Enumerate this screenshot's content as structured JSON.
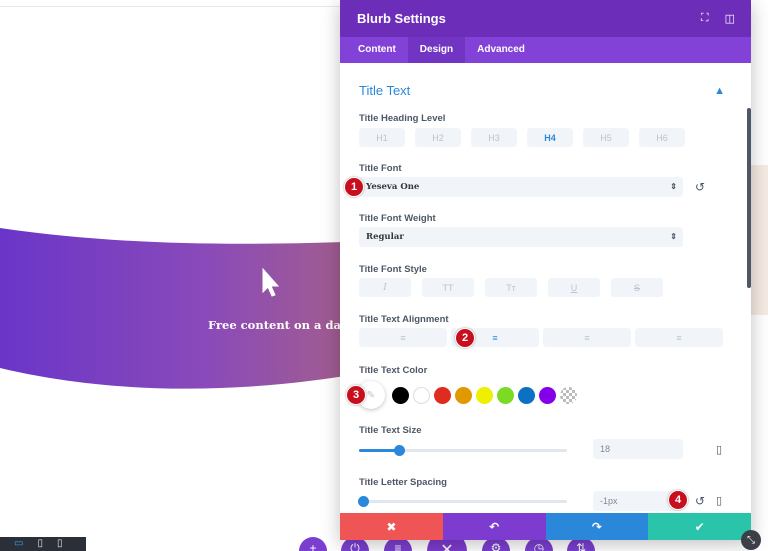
{
  "canvas": {
    "hero_text": "Free content on a daily",
    "device_icons": [
      "▭",
      "▯",
      "▯"
    ],
    "fab_icons": [
      "+",
      "⏻",
      "≡",
      "✕",
      "⚙",
      "◷",
      "⇅"
    ]
  },
  "modal": {
    "title": "Blurb Settings",
    "head_icons": [
      "⛶",
      "◫"
    ],
    "tabs": [
      {
        "label": "Content",
        "active": false
      },
      {
        "label": "Design",
        "active": true
      },
      {
        "label": "Advanced",
        "active": false
      }
    ]
  },
  "section": {
    "title": "Title Text",
    "chevron": "▲"
  },
  "heading_level": {
    "label": "Title Heading Level",
    "options": [
      "H1",
      "H2",
      "H3",
      "H4",
      "H5",
      "H6"
    ],
    "selected_index": 3
  },
  "font": {
    "label": "Title Font",
    "value": "Yeseva One",
    "arrows": "⇕"
  },
  "font_weight": {
    "label": "Title Font Weight",
    "value": "Regular",
    "arrows": "⇕"
  },
  "font_style": {
    "label": "Title Font Style",
    "options": [
      "I",
      "TT",
      "Tт",
      "U",
      "S"
    ]
  },
  "alignment": {
    "label": "Title Text Alignment",
    "options": [
      "≡",
      "≡",
      "≡",
      "≡"
    ],
    "selected_index": 1
  },
  "text_color": {
    "label": "Title Text Color",
    "eyedropper_icon": "✎",
    "swatches": [
      "#000000",
      "#ffffff",
      "#e02b20",
      "#e09900",
      "#edf000",
      "#7cda24",
      "#0c71c3",
      "#8300e9",
      "none"
    ]
  },
  "text_size": {
    "label": "Title Text Size",
    "value": "18",
    "slider_fraction": 0.19
  },
  "letter_spacing": {
    "label": "Title Letter Spacing",
    "value": "-1px",
    "slider_fraction": 0.02
  },
  "markers": [
    "1",
    "2",
    "3",
    "4"
  ],
  "footer": {
    "cancel": "✖",
    "undo": "↶",
    "redo": "↷",
    "save": "✔"
  },
  "resize_icon": "⤡"
}
